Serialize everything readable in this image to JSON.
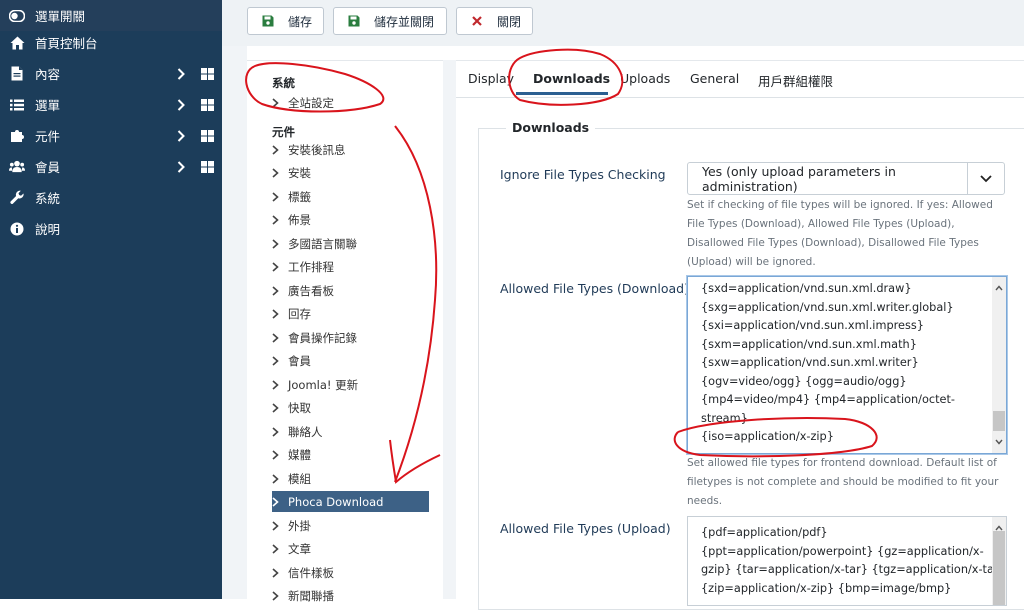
{
  "sidebar": {
    "items": [
      {
        "label": "選單開關",
        "icon": "toggle-icon"
      },
      {
        "label": "首頁控制台",
        "icon": "home-icon"
      },
      {
        "label": "內容",
        "icon": "file-icon"
      },
      {
        "label": "選單",
        "icon": "list-icon"
      },
      {
        "label": "元件",
        "icon": "puzzle-icon"
      },
      {
        "label": "會員",
        "icon": "users-icon"
      },
      {
        "label": "系統",
        "icon": "wrench-icon"
      },
      {
        "label": "說明",
        "icon": "info-icon"
      }
    ]
  },
  "toolbar": {
    "save_label": "儲存",
    "save_close_label": "儲存並關閉",
    "close_label": "關閉"
  },
  "tree": {
    "system_heading": "系統",
    "global_config": "全站設定",
    "components_heading": "元件",
    "items": [
      "安裝後訊息",
      "安裝",
      "標籤",
      "佈景",
      "多國語言關聯",
      "工作排程",
      "廣告看板",
      "回存",
      "會員操作記錄",
      "會員",
      "Joomla! 更新",
      "快取",
      "聯絡人",
      "媒體",
      "模組",
      "Phoca Download",
      "外掛",
      "文章",
      "信件樣板",
      "新聞聯播"
    ],
    "active_item": "Phoca Download"
  },
  "tabs": [
    "Display",
    "Downloads",
    "Uploads",
    "General",
    "用戶群組權限"
  ],
  "active_tab": "Downloads",
  "fieldset_legend": "Downloads",
  "fields": {
    "ignore_label": "Ignore File Types Checking",
    "ignore_value": "Yes (only upload parameters in administration)",
    "ignore_help": "Set if checking of file types will be ignored. If yes: Allowed File Types (Download), Allowed File Types (Upload), Disallowed File Types (Download), Disallowed File Types (Upload) will be ignored.",
    "download_label": "Allowed File Types (Download)",
    "download_lines": [
      "{sxd=application/vnd.sun.xml.draw}",
      "{sxg=application/vnd.sun.xml.writer.global}",
      "{sxi=application/vnd.sun.xml.impress}",
      "{sxm=application/vnd.sun.xml.math}",
      "{sxw=application/vnd.sun.xml.writer}",
      "{ogv=video/ogg} {ogg=audio/ogg}",
      "{mp4=video/mp4} {mp4=application/octet-",
      "stream}",
      "{iso=application/x-zip}"
    ],
    "download_help": "Set allowed file types for frontend download. Default list of filetypes is not complete and should be modified to fit your needs.",
    "upload_label": "Allowed File Types (Upload)",
    "upload_lines": [
      "{pdf=application/pdf}",
      "{ppt=application/powerpoint} {gz=application/x-",
      "gzip} {tar=application/x-tar} {tgz=application/x-tar}",
      "{zip=application/x-zip} {bmp=image/bmp}"
    ]
  },
  "colors": {
    "sidebar_bg": "#1c3d5a",
    "active_tree_bg": "#3d6186",
    "save_icon": "#2a7d3f",
    "close_icon": "#c0282d",
    "annotation": "#d9141c"
  }
}
